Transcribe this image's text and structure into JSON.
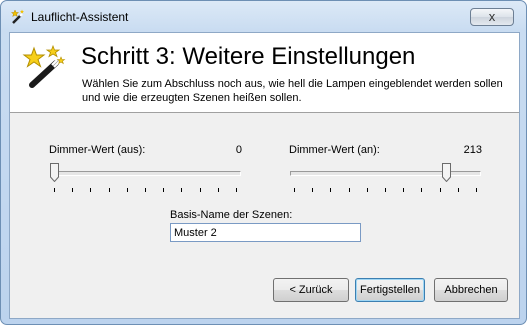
{
  "window": {
    "title": "Lauflicht-Assistent",
    "close_symbol": "x",
    "title_icon": "wand-icon"
  },
  "header": {
    "title": "Schritt 3: Weitere Einstellungen",
    "description": "Wählen Sie zum Abschluss noch aus, wie hell die Lampen eingeblendet werden sollen und wie die erzeugten Szenen heißen sollen.",
    "icon": "magic-wand-stars-icon"
  },
  "dimmer_off": {
    "label": "Dimmer-Wert (aus):",
    "value": "0",
    "level": 0
  },
  "dimmer_on": {
    "label": "Dimmer-Wert (an):",
    "value": "213",
    "level": 213
  },
  "slider_max": 255,
  "basis_name": {
    "label": "Basis-Name der Szenen:",
    "value": "Muster 2"
  },
  "buttons": {
    "back": "< Zurück",
    "finish": "Fertigstellen",
    "cancel": "Abbrechen"
  },
  "colors": {
    "title_bar": "#c9dcf1",
    "client_bg": "#f0f0f0",
    "header_bg": "#ffffff"
  }
}
